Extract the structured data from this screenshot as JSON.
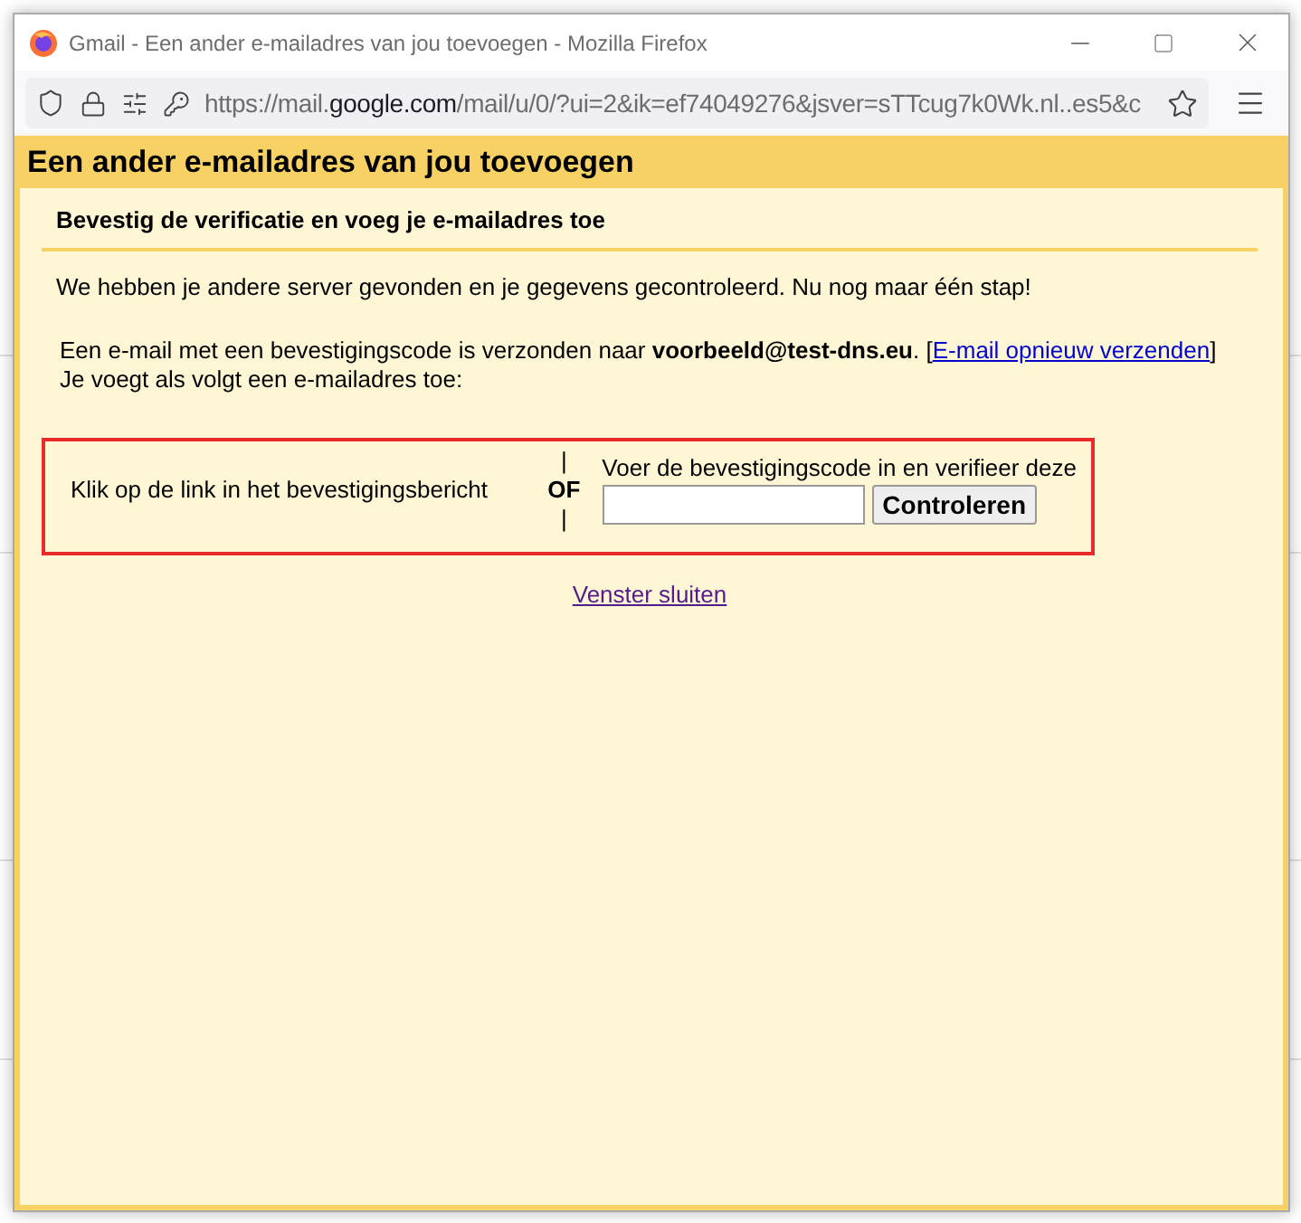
{
  "window": {
    "title": "Gmail - Een ander e-mailadres van jou toevoegen - Mozilla Firefox"
  },
  "address_bar": {
    "url_prefix": "https://mail.",
    "url_domain": "google.com",
    "url_rest": "/mail/u/0/?ui=2&ik=ef74049276&jsver=sTTcug7k0Wk.nl..es5&c"
  },
  "page_header": "Een ander e-mailadres van jou toevoegen",
  "section_title": "Bevestig de verificatie en voeg je e-mailadres toe",
  "intro": "We hebben je andere server gevonden en je gegevens gecontroleerd. Nu nog maar één stap!",
  "sent_notice": "Een e-mail met een bevestigingscode is verzonden naar **voorbeeld@test-dns.eu**. [",
  "resend_link": "E-mail opnieuw verzenden",
  "resend_close": "]",
  "adding_note": "Je voegt als volgt een e-mailadres toe:",
  "option_link": "Klik op de link in het bevestigingsbericht",
  "separator": {
    "bar_top": "|",
    "label": "OF",
    "bar_bottom": "|"
  },
  "option_code": {
    "label": "Voer de bevestigingscode in en verifieer deze",
    "button": "Controleren"
  },
  "close_link": "Venster sluiten"
}
